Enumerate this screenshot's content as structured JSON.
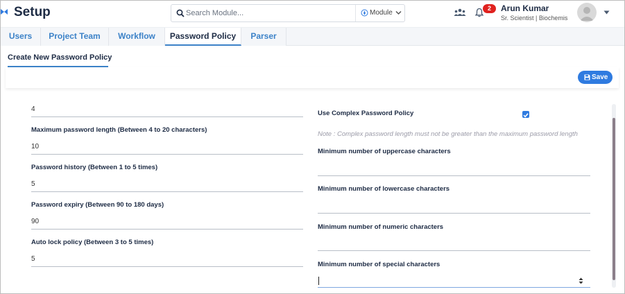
{
  "header": {
    "app_title": "Setup",
    "search_placeholder": "Search Module...",
    "module_label": "Module",
    "notification_count": "2",
    "user_name": "Arun Kumar",
    "user_role": "Sr. Scientist | Biochemis"
  },
  "tabs": [
    {
      "label": "Users",
      "active": false
    },
    {
      "label": "Project Team",
      "active": false
    },
    {
      "label": "Workflow",
      "active": false
    },
    {
      "label": "Password Policy",
      "active": true
    },
    {
      "label": "Parser",
      "active": false
    }
  ],
  "subheader": {
    "title": "Create New Password Policy",
    "save_label": "Save"
  },
  "form": {
    "left": {
      "min_length_value": "4",
      "max_length_label": "Maximum password length (Between 4 to 20 characters)",
      "max_length_value": "10",
      "history_label": "Password history (Between 1 to 5 times)",
      "history_value": "5",
      "expiry_label": "Password expiry (Between 90 to 180 days)",
      "expiry_value": "90",
      "autolock_label": "Auto lock policy (Between 3 to 5 times)",
      "autolock_value": "5"
    },
    "right": {
      "complex_label": "Use Complex Password Policy",
      "complex_checked": true,
      "note": "Note : Complex password length must not be greater than the maximum password length",
      "uppercase_label": "Minimum number of uppercase characters",
      "uppercase_value": "",
      "lowercase_label": "Minimum number of lowercase characters",
      "lowercase_value": "",
      "numeric_label": "Minimum number of numeric characters",
      "numeric_value": "",
      "special_label": "Minimum number of special characters",
      "special_value": ""
    }
  },
  "colors": {
    "accent": "#2f7be0",
    "tab_text": "#3c82c8",
    "heading": "#1d2b44",
    "badge": "#e0221f"
  },
  "icons": [
    "collapse-icon",
    "search-icon",
    "module-icon",
    "chevron-down-icon",
    "team-icon",
    "bell-icon",
    "avatar-icon",
    "save-icon",
    "checkmark-icon",
    "stepper-arrows-icon"
  ]
}
